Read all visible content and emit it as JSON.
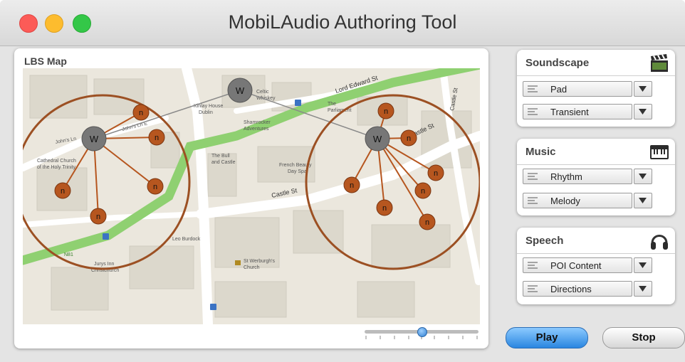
{
  "window": {
    "title": "MobiLAudio Authoring Tool"
  },
  "map_panel": {
    "title": "LBS Map",
    "labels": {
      "lord_edward": "Lord Edward St",
      "castle_st": "Castle St",
      "castle_st2": "Castle St",
      "castle_st_vert": "Castle St",
      "celtic": "Celtic",
      "celtic2": "Whiskey",
      "kinlay": "Kinlay House",
      "kinlay2": "Dublin",
      "the_parliament": "The",
      "the_parliament2": "Parliament",
      "shamrocker": "Shamrocker",
      "shamrocker2": "Adventures",
      "bull": "The Bull",
      "bull2": "and Castle",
      "french": "French Beauty",
      "french2": "Day Spa",
      "johns_ln": "John's Ln E",
      "johns_ln2": "John's Ln",
      "cathedral": "Cathedral Church",
      "cathedral2": "of the Holy Trinity",
      "leo": "Leo Burdock",
      "st_werburgh": "St Werburgh's",
      "st_werburgh2": "Church",
      "jurys": "Jurys Inn",
      "jurys2": "Christchurch",
      "route": "N81",
      "w": "W",
      "n": "n"
    }
  },
  "panels": {
    "soundscape": {
      "title": "Soundscape",
      "icon": "clapperboard-icon",
      "items": [
        "Pad",
        "Transient"
      ]
    },
    "music": {
      "title": "Music",
      "icon": "keyboard-icon",
      "items": [
        "Rhythm",
        "Melody"
      ]
    },
    "speech": {
      "title": "Speech",
      "icon": "headphones-icon",
      "items": [
        "POI Content",
        "Directions"
      ]
    }
  },
  "buttons": {
    "play": "Play",
    "stop": "Stop"
  },
  "colors": {
    "circle": "#9c5023",
    "node": "#b6561f",
    "hub": "#777777",
    "park": "#8fd071",
    "play": "#2a86e0"
  }
}
